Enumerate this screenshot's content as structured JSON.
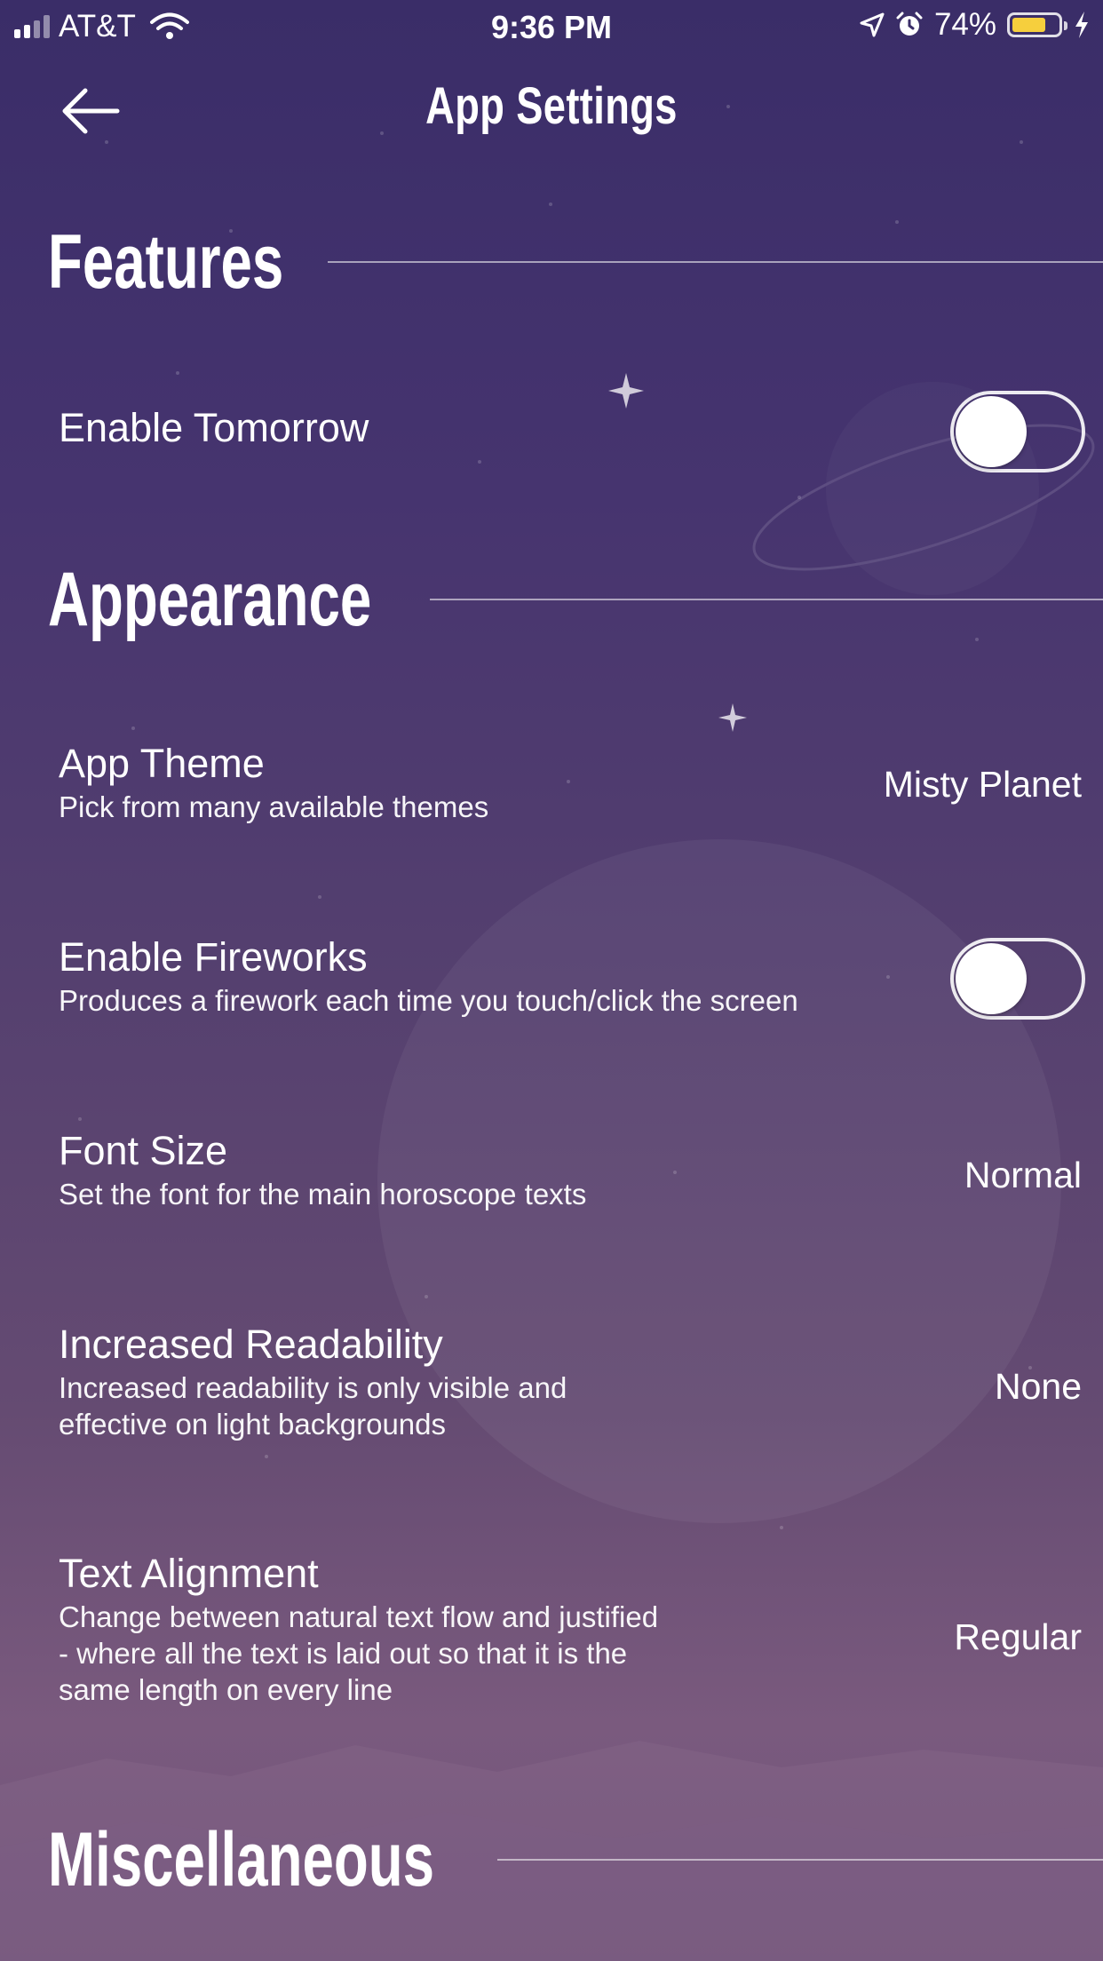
{
  "status_bar": {
    "carrier": "AT&T",
    "time": "9:36 PM",
    "battery_percent": "74%",
    "battery_level": 0.74,
    "battery_color": "#f6cf3d",
    "icons": [
      "signal-icon",
      "wifi-icon",
      "location-arrow-icon",
      "alarm-icon",
      "battery-icon",
      "charging-bolt-icon"
    ]
  },
  "nav": {
    "title": "App Settings",
    "back_icon": "back-arrow-icon"
  },
  "sections": {
    "features": {
      "title": "Features"
    },
    "appearance": {
      "title": "Appearance"
    },
    "misc": {
      "title": "Miscellaneous"
    }
  },
  "settings": {
    "enable_tomorrow": {
      "title": "Enable Tomorrow",
      "enabled": false
    },
    "app_theme": {
      "title": "App Theme",
      "subtitle": "Pick from many available themes",
      "value": "Misty Planet"
    },
    "enable_fireworks": {
      "title": "Enable Fireworks",
      "subtitle": "Produces a firework each time you touch/click the screen",
      "enabled": false
    },
    "font_size": {
      "title": "Font Size",
      "subtitle": "Set the font for the main horoscope texts",
      "value": "Normal"
    },
    "increased_readability": {
      "title": "Increased Readability",
      "subtitle_line1": "Increased readability is only visible and",
      "subtitle_line2": "effective on light backgrounds",
      "value": "None"
    },
    "text_alignment": {
      "title": "Text Alignment",
      "subtitle_line1": "Change between natural text flow and justified",
      "subtitle_line2": "- where all the text is laid out so that it is the",
      "subtitle_line3": "same length on every line",
      "value": "Regular"
    }
  },
  "theme": {
    "background_top": "#3a2d68",
    "background_bottom": "#7a5a7e",
    "text": "#ffffff"
  }
}
